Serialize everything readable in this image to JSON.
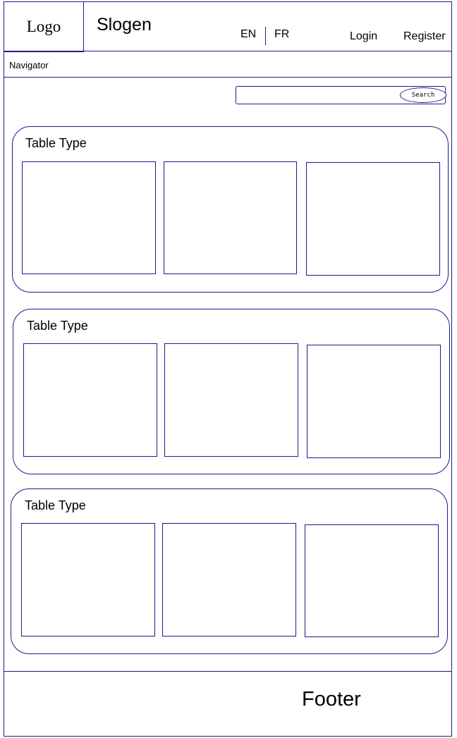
{
  "header": {
    "logo": "Logo",
    "slogan": "Slogen",
    "languages": [
      "EN",
      "FR"
    ],
    "login": "Login",
    "register": "Register"
  },
  "nav": {
    "label": "Navigator"
  },
  "search": {
    "placeholder": "",
    "button": "Search"
  },
  "sections": [
    {
      "title": "Table Type",
      "cards": [
        "",
        "",
        ""
      ]
    },
    {
      "title": "Table Type",
      "cards": [
        "",
        "",
        ""
      ]
    },
    {
      "title": "Table Type",
      "cards": [
        "",
        "",
        ""
      ]
    }
  ],
  "footer": {
    "label": "Footer"
  },
  "colors": {
    "line": "#1a1a8c",
    "background": "#ffffff",
    "text": "#000000"
  }
}
